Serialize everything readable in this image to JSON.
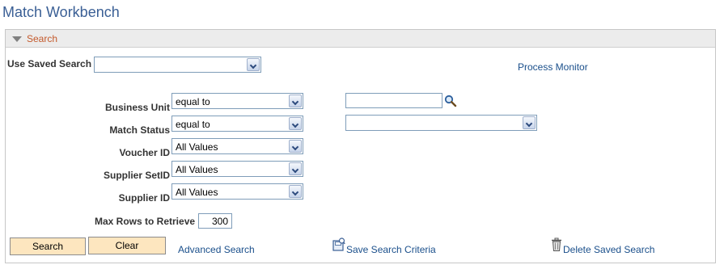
{
  "page_title": "Match Workbench",
  "search_panel": {
    "title": "Search",
    "collapse_icon": "triangle-down-icon"
  },
  "saved_search": {
    "label": "Use Saved Search",
    "value": ""
  },
  "process_monitor_link": "Process Monitor",
  "criteria": {
    "business_unit": {
      "label": "Business Unit",
      "operator": "equal to",
      "value": ""
    },
    "match_status": {
      "label": "Match Status",
      "operator": "equal to",
      "value": ""
    },
    "voucher_id": {
      "label": "Voucher ID",
      "operator": "All Values"
    },
    "supplier_setid": {
      "label": "Supplier SetID",
      "operator": "All Values"
    },
    "supplier_id": {
      "label": "Supplier ID",
      "operator": "All Values"
    }
  },
  "max_rows": {
    "label": "Max Rows to Retrieve",
    "value": "300"
  },
  "buttons": {
    "search": "Search",
    "clear": "Clear"
  },
  "links": {
    "advanced_search": "Advanced Search",
    "save_search_criteria": "Save Search Criteria",
    "delete_saved_search": "Delete Saved Search"
  },
  "icons": {
    "lookup": "magnifier-icon",
    "save": "save-criteria-icon",
    "delete": "trash-icon"
  },
  "colors": {
    "title": "#3a5f95",
    "panel_title": "#c45a2c",
    "link": "#1a4f8b",
    "button_bg": "#fde6bf"
  }
}
